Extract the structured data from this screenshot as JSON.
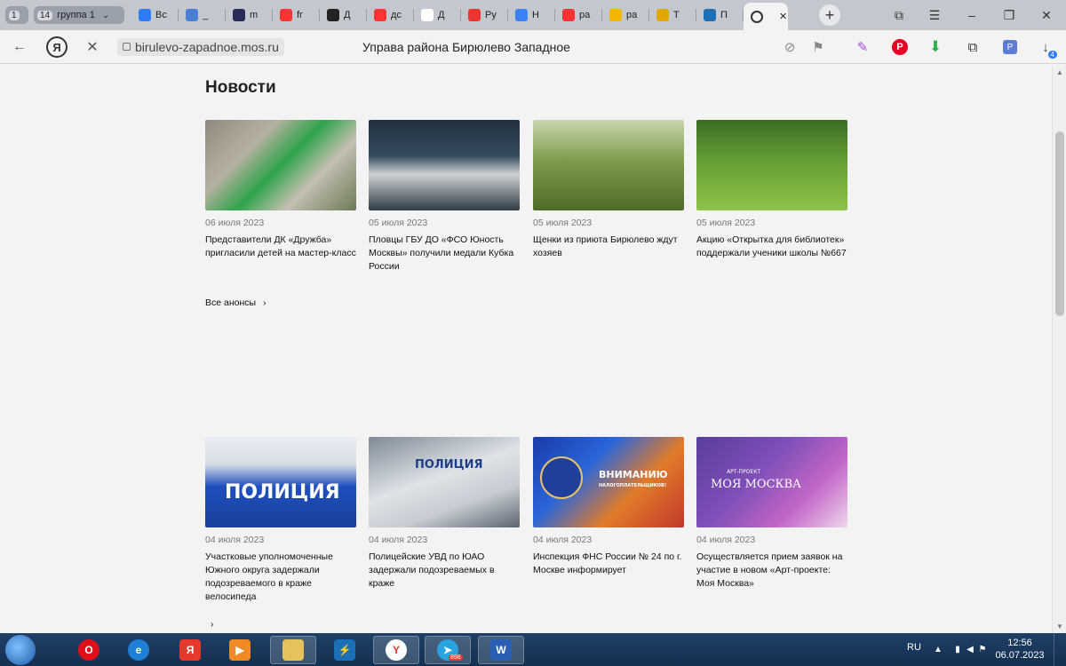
{
  "browser": {
    "tabs": [
      {
        "label": "Вс",
        "icon": "blue-circle-icon",
        "color": "#2d7cf6"
      },
      {
        "label": "_",
        "icon": "doc-icon",
        "color": "#4a7fd6"
      },
      {
        "label": "m",
        "icon": "dark-icon",
        "color": "#2a2a5a"
      },
      {
        "label": "fr",
        "icon": "yandex-icon",
        "color": "#f33"
      },
      {
        "label": "Д",
        "icon": "star-icon",
        "color": "#222"
      },
      {
        "label": "дс",
        "icon": "yandex-icon",
        "color": "#f33"
      },
      {
        "label": "Д",
        "icon": "wikipedia-icon",
        "color": "#fff"
      },
      {
        "label": "Ру",
        "icon": "red-square-icon",
        "color": "#e33"
      },
      {
        "label": "Н",
        "icon": "cube-icon",
        "color": "#3b82f6"
      },
      {
        "label": "ра",
        "icon": "yandex-icon",
        "color": "#f33"
      },
      {
        "label": "ра",
        "icon": "photo-icon",
        "color": "#f4b400"
      },
      {
        "label": "Т",
        "icon": "excavator-icon",
        "color": "#e0a800"
      },
      {
        "label": "П",
        "icon": "globe-icon",
        "color": "#1d6fb8"
      },
      {
        "label": "",
        "icon": "loading-icon",
        "color": "#333"
      }
    ],
    "group": {
      "count": "14",
      "label": "группа 1"
    },
    "pinned_count": "1",
    "url_host": "birulevo-zapadnoe.mos.ru",
    "page_title": "Управа района Бирюлево Западное",
    "extension_badge": "4"
  },
  "page": {
    "section_title": "Новости",
    "more_label": "Все анонсы",
    "news": [
      {
        "date": "06 июля 2023",
        "title": "Представители ДК «Дружба» пригласили детей на мастер-класс"
      },
      {
        "date": "05 июля 2023",
        "title": "Пловцы ГБУ ДО «ФСО Юность Москвы» получили медали Кубка России"
      },
      {
        "date": "05 июля 2023",
        "title": "Щенки из приюта Бирюлево ждут хозяев"
      },
      {
        "date": "05 июля 2023",
        "title": "Акцию «Открытка для библиотек» поддержали ученики школы №667"
      },
      {
        "date": "04 июля 2023",
        "title": "Участковые уполномоченные Южного округа задержали подозреваемого в краже велосипеда"
      },
      {
        "date": "04 июля 2023",
        "title": "Полицейские УВД по ЮАО задержали подозреваемых в краже"
      },
      {
        "date": "04 июля 2023",
        "title": "Инспекция ФНС России № 24 по г. Москве информирует"
      },
      {
        "date": "04 июля 2023",
        "title": "Осуществляется прием заявок на участие в новом «Арт-проекте: Моя Москва»"
      }
    ],
    "image_texts": {
      "police_1": "ПОЛИЦИЯ",
      "police_2": "ПОЛИЦИЯ",
      "tax_banner": "ВНИМАНИЮ",
      "tax_sub": "НАЛОГОПЛАТЕЛЬЩИКОВ!",
      "art_top": "АРТ-ПРОЕКТ",
      "art_main": "МОЯ МОСКВА"
    }
  },
  "taskbar": {
    "language": "RU",
    "time": "12:56",
    "date": "06.07.2023",
    "telegram_badge": "898"
  }
}
